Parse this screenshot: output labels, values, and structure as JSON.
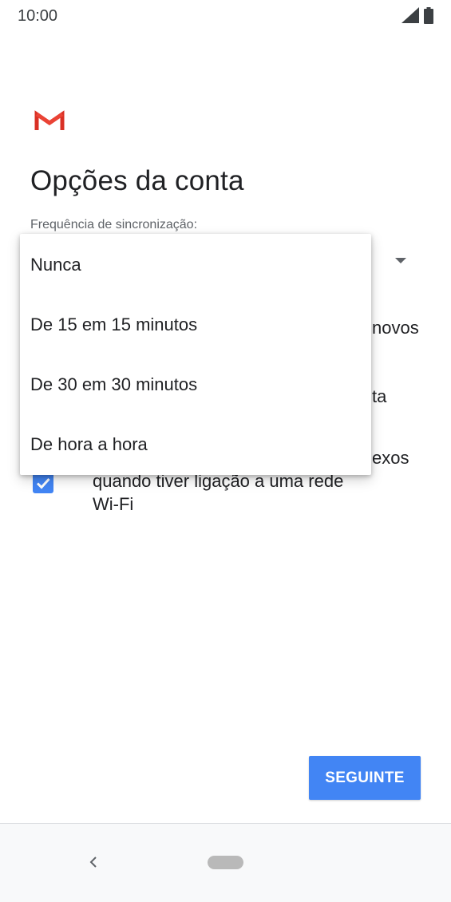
{
  "status_bar": {
    "time": "10:00",
    "icons": [
      "signal-icon",
      "battery-icon"
    ]
  },
  "app": {
    "logo_icon": "gmail-logo-icon",
    "title": "Opções da conta"
  },
  "sync": {
    "label": "Frequência de sincronização:"
  },
  "background_options": {
    "opt1_fragment": "novos",
    "opt2_fragment": "ta",
    "opt3_fragment_line1": "exos",
    "opt3_line2": "quando tiver ligação a uma rede",
    "opt3_line3": "Wi-Fi"
  },
  "dropdown": {
    "items": [
      {
        "label": "Nunca"
      },
      {
        "label": "De 15 em 15 minutos"
      },
      {
        "label": "De 30 em 30 minutos"
      },
      {
        "label": "De hora a hora"
      }
    ]
  },
  "actions": {
    "next_label": "SEGUINTE"
  },
  "nav_bar": {
    "icons": [
      "back-icon",
      "home-pill-icon"
    ]
  },
  "colors": {
    "accent": "#4285f4",
    "gmail_red": "#d93025",
    "text_primary": "#202124",
    "text_secondary": "#5f6368"
  }
}
